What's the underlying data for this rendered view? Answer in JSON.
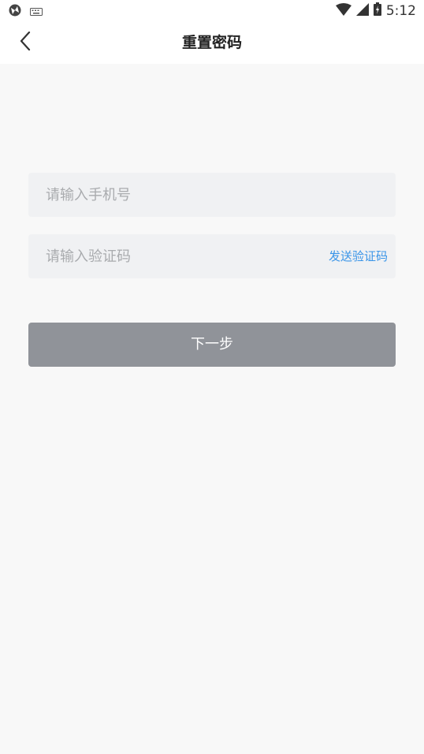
{
  "status_bar": {
    "time": "5:12",
    "left_icons": [
      "browser-icon",
      "keyboard-icon"
    ],
    "right_icons": [
      "wifi-icon",
      "signal-icon",
      "battery-icon"
    ]
  },
  "header": {
    "title": "重置密码",
    "back_icon": "chevron-left-icon"
  },
  "form": {
    "phone_placeholder": "请输入手机号",
    "code_placeholder": "请输入验证码",
    "send_code_label": "发送验证码",
    "next_label": "下一步"
  },
  "colors": {
    "link": "#3a95e8",
    "button_disabled": "#909399",
    "input_bg": "#f0f1f3",
    "page_bg": "#f8f8f8"
  }
}
